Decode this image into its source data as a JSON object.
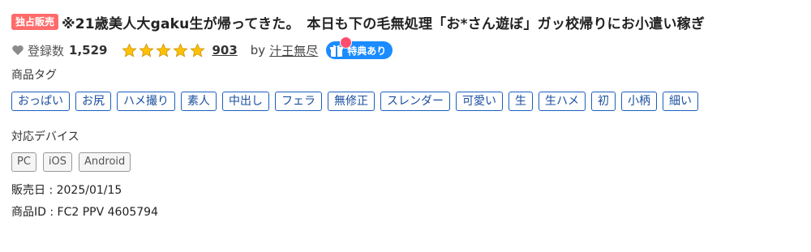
{
  "title": {
    "badge": "独占販売",
    "text": "※21歳美人大gaku生が帰ってきた。　本日も下の毛無処理「お*さん遊ぼ」ガッ校帰りにお小遣い稼ぎ"
  },
  "meta": {
    "favorite_label": "登録数",
    "favorite_count": "1,529",
    "rating_stars": 5,
    "review_count": "903",
    "by_label": "by",
    "seller": "汁王無尽",
    "bonus_badge": "特典あり"
  },
  "tags": {
    "label": "商品タグ",
    "items": [
      "おっぱい",
      "お尻",
      "ハメ撮り",
      "素人",
      "中出し",
      "フェラ",
      "無修正",
      "スレンダー",
      "可愛い",
      "生",
      "生ハメ",
      "初",
      "小柄",
      "細い"
    ]
  },
  "devices": {
    "label": "対応デバイス",
    "items": [
      "PC",
      "iOS",
      "Android"
    ]
  },
  "info": {
    "release_date": "販売日 : 2025/01/15",
    "product_id": "商品ID : FC2 PPV 4605794"
  },
  "colors": {
    "badge": "#ff6b6b",
    "star": "#ffc107",
    "tag_border": "#1a5fbf",
    "bonus": "#1a8cff"
  }
}
